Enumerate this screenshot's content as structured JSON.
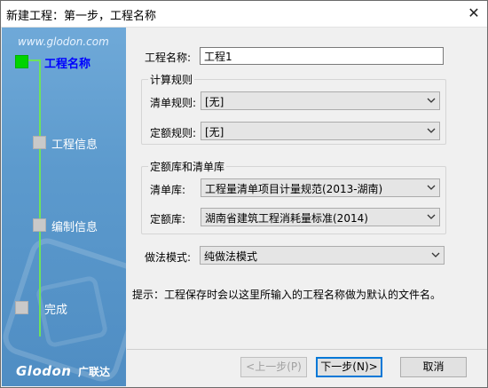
{
  "window": {
    "title": "新建工程：第一步，工程名称",
    "close_glyph": "✕"
  },
  "sidebar": {
    "site_url": "www.glodon.com",
    "steps": [
      {
        "label": "工程名称",
        "active": true
      },
      {
        "label": "工程信息",
        "active": false
      },
      {
        "label": "编制信息",
        "active": false
      },
      {
        "label": "完成",
        "active": false
      }
    ],
    "brand": "Glodon",
    "brand_cn": "广联达",
    "accent_color": "#00d400",
    "active_label_color": "#0000ff"
  },
  "form": {
    "project_name_label": "工程名称:",
    "project_name_value": "工程1",
    "calc_rules_group": {
      "title": "计算规则",
      "list_rule_label": "清单规则:",
      "list_rule_value": "[无]",
      "quota_rule_label": "定额规则:",
      "quota_rule_value": "[无]"
    },
    "library_group": {
      "title": "定额库和清单库",
      "list_lib_label": "清单库:",
      "list_lib_value": "工程量清单项目计量规范(2013-湖南)",
      "quota_lib_label": "定额库:",
      "quota_lib_value": "湖南省建筑工程消耗量标准(2014)"
    },
    "method_label": "做法模式:",
    "method_value": "纯做法模式"
  },
  "hint": "提示：工程保存时会以这里所输入的工程名称做为默认的文件名。",
  "buttons": {
    "prev": "<上一步(P)",
    "next": "下一步(N)>",
    "cancel": "取消"
  }
}
